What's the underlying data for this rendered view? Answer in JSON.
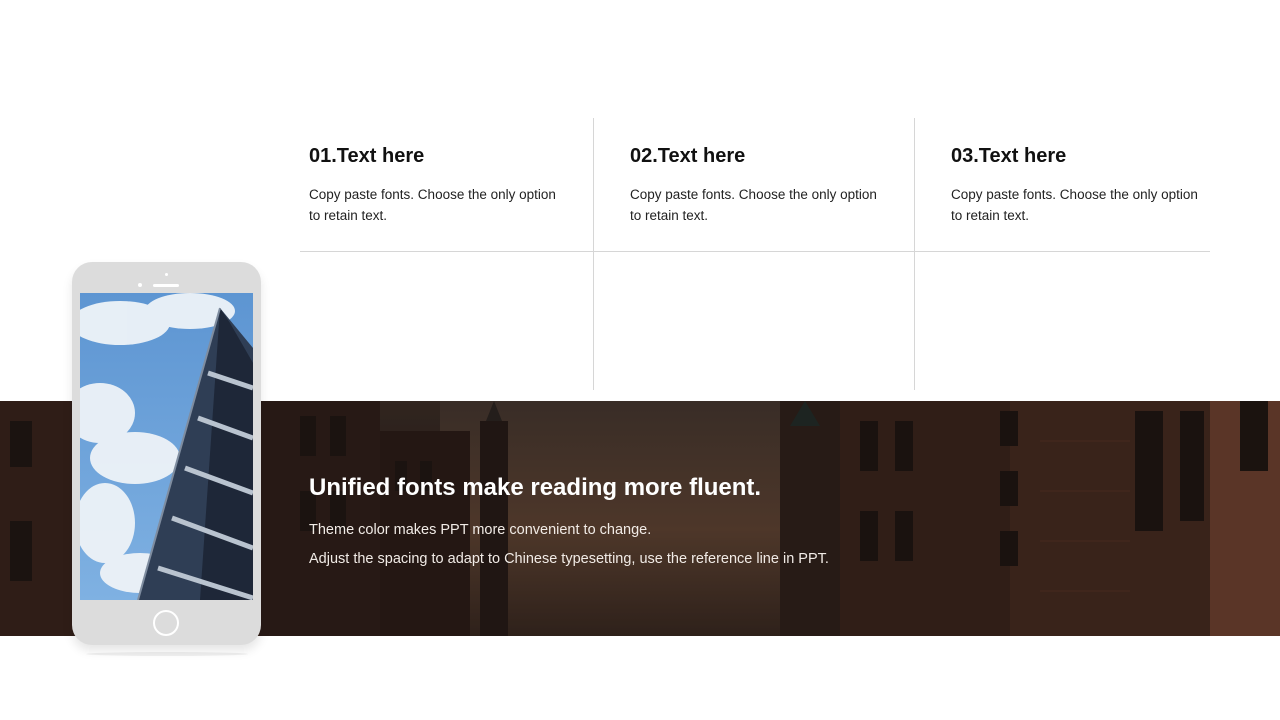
{
  "columns": [
    {
      "title": "01.Text here",
      "body_line1": "Copy paste fonts. Choose the only option",
      "body_line2": "to retain text."
    },
    {
      "title": "02.Text here",
      "body_line1": "Copy paste fonts. Choose the only option",
      "body_line2": "to retain text."
    },
    {
      "title": "03.Text here",
      "body_line1": "Copy paste fonts. Choose the only option",
      "body_line2": "to retain text."
    }
  ],
  "band": {
    "title": "Unified fonts make reading more fluent.",
    "line1": "Theme color makes PPT more convenient to change.",
    "line2": "Adjust the spacing to adapt to Chinese typesetting, use the reference line in PPT."
  },
  "colors": {
    "divider": "#d6d6d6",
    "phone_body": "#dcdcdc",
    "band_overlay": "#2b211c",
    "brick": "#5a3527"
  }
}
